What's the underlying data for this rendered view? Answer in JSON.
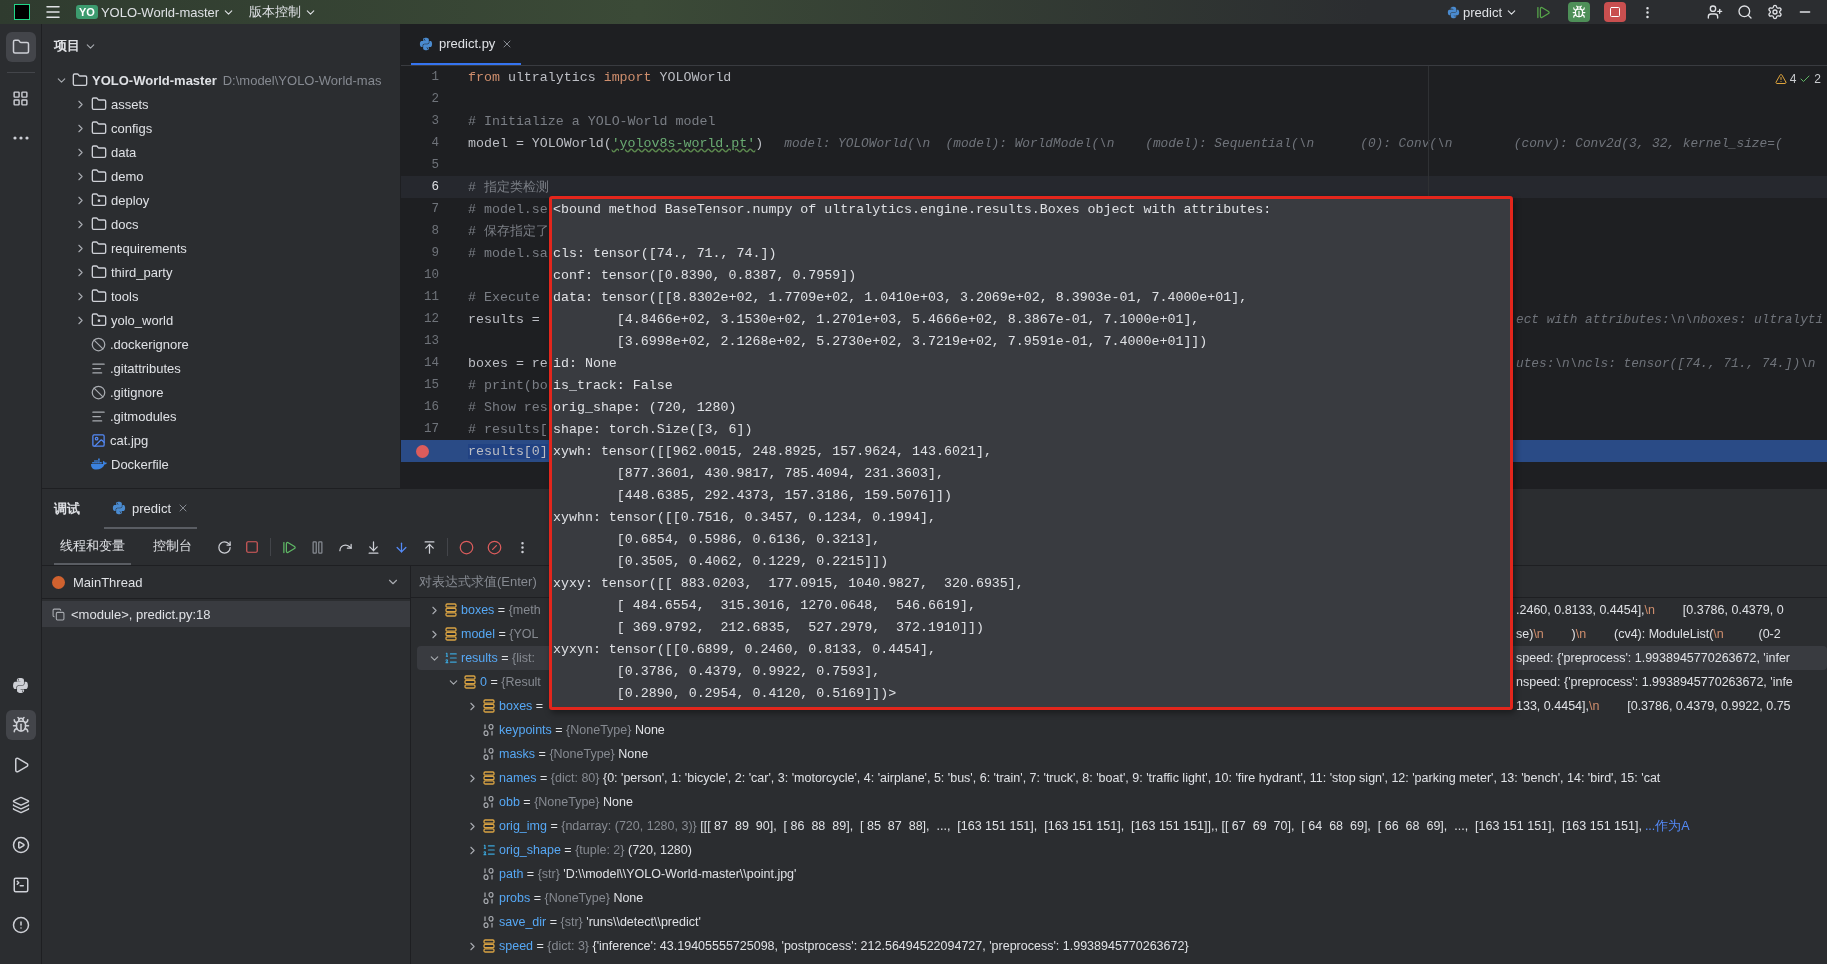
{
  "top_bar": {
    "project_badge": "YO",
    "project": "YOLO-World-master",
    "vcs": "版本控制",
    "run_config": "predict"
  },
  "project_panel": {
    "title": "项目",
    "tree": [
      {
        "name": "YOLO-World-master",
        "path": "D:\\model\\YOLO-World-mas",
        "kind": "folder",
        "expanded": true,
        "children": [
          {
            "name": "assets",
            "kind": "folder",
            "expanded": false
          },
          {
            "name": "configs",
            "kind": "folder",
            "expanded": false
          },
          {
            "name": "data",
            "kind": "folder",
            "expanded": false
          },
          {
            "name": "demo",
            "kind": "folder",
            "expanded": false
          },
          {
            "name": "deploy",
            "kind": "module",
            "expanded": false
          },
          {
            "name": "docs",
            "kind": "folder",
            "expanded": false
          },
          {
            "name": "requirements",
            "kind": "folder",
            "expanded": false
          },
          {
            "name": "third_party",
            "kind": "folder",
            "expanded": false
          },
          {
            "name": "tools",
            "kind": "folder",
            "expanded": false
          },
          {
            "name": "yolo_world",
            "kind": "module",
            "expanded": false
          },
          {
            "name": ".dockerignore",
            "kind": "ignore"
          },
          {
            "name": ".gitattributes",
            "kind": "text"
          },
          {
            "name": ".gitignore",
            "kind": "ignore"
          },
          {
            "name": ".gitmodules",
            "kind": "text"
          },
          {
            "name": "cat.jpg",
            "kind": "image"
          },
          {
            "name": "Dockerfile",
            "kind": "docker"
          }
        ]
      }
    ]
  },
  "editor": {
    "tab": "predict.py",
    "warnings": "4",
    "checks": "2",
    "lines": [
      {
        "number": "1",
        "current": false,
        "paused": false,
        "breakpoint": false,
        "code": [
          {
            "kind": "keyword",
            "text": "from"
          },
          {
            "kind": "plain",
            "text": " ultralytics "
          },
          {
            "kind": "keyword",
            "text": "import"
          },
          {
            "kind": "plain",
            "text": " YOLOWorld"
          }
        ]
      },
      {
        "number": "2",
        "current": false,
        "paused": false,
        "breakpoint": false
      },
      {
        "number": "3",
        "current": false,
        "paused": false,
        "breakpoint": false,
        "code": [
          {
            "kind": "comment",
            "text": "# Initialize a YOLO-World model"
          }
        ]
      },
      {
        "number": "4",
        "current": false,
        "paused": false,
        "breakpoint": false,
        "code": [
          {
            "kind": "plain",
            "text": "model = YOLOWorld("
          },
          {
            "kind": "string",
            "text": "'yolov8s-world.pt'"
          },
          {
            "kind": "plain",
            "text": ")"
          }
        ],
        "hint": "model: YOLOWorld(\\n  (model): WorldModel(\\n    (model): Sequential(\\n      (0): Conv(\\n        (conv): Conv2d(3, 32, kernel_size=("
      },
      {
        "number": "5",
        "current": false,
        "paused": false,
        "breakpoint": false
      },
      {
        "number": "6",
        "current": true,
        "paused": false,
        "breakpoint": false,
        "code": [
          {
            "kind": "comment",
            "text": "# 指定类检测"
          }
        ]
      },
      {
        "number": "7",
        "current": false,
        "paused": false,
        "breakpoint": false,
        "code": [
          {
            "kind": "comment",
            "text": "# model.se"
          }
        ]
      },
      {
        "number": "8",
        "current": false,
        "paused": false,
        "breakpoint": false,
        "code": [
          {
            "kind": "comment",
            "text": "# 保存指定了"
          }
        ]
      },
      {
        "number": "9",
        "current": false,
        "paused": false,
        "breakpoint": false,
        "code": [
          {
            "kind": "comment",
            "text": "# model.sa"
          }
        ]
      },
      {
        "number": "10",
        "current": false,
        "paused": false,
        "breakpoint": false
      },
      {
        "number": "11",
        "current": false,
        "paused": false,
        "breakpoint": false,
        "code": [
          {
            "kind": "comment",
            "text": "# Execute"
          }
        ]
      },
      {
        "number": "12",
        "current": false,
        "paused": false,
        "breakpoint": false,
        "code": [
          {
            "kind": "plain",
            "text": "results ="
          }
        ],
        "hint_after_popup": "ect with attributes:\\n\\nboxes: ultralyti"
      },
      {
        "number": "13",
        "current": false,
        "paused": false,
        "breakpoint": false
      },
      {
        "number": "14",
        "current": false,
        "paused": false,
        "breakpoint": false,
        "code": [
          {
            "kind": "plain",
            "text": "boxes = re"
          }
        ],
        "hint_after_popup": "utes:\\n\\ncls: tensor([74., 71., 74.])\\n"
      },
      {
        "number": "15",
        "current": false,
        "paused": false,
        "breakpoint": false,
        "code": [
          {
            "kind": "comment",
            "text": "# print(bo"
          }
        ]
      },
      {
        "number": "16",
        "current": false,
        "paused": false,
        "breakpoint": false,
        "code": [
          {
            "kind": "comment",
            "text": "# Show res"
          }
        ]
      },
      {
        "number": "17",
        "current": false,
        "paused": false,
        "breakpoint": false,
        "code": [
          {
            "kind": "comment",
            "text": "# results["
          }
        ]
      },
      {
        "current": false,
        "paused": true,
        "breakpoint": true,
        "code": [
          {
            "kind": "selection",
            "text": "results[0]"
          }
        ]
      }
    ]
  },
  "popup": {
    "text": "<bound method BaseTensor.numpy of ultralytics.engine.results.Boxes object with attributes:\n\ncls: tensor([74., 71., 74.])\nconf: tensor([0.8390, 0.8387, 0.7959])\ndata: tensor([[8.8302e+02, 1.7709e+02, 1.0410e+03, 3.2069e+02, 8.3903e-01, 7.4000e+01],\n        [4.8466e+02, 3.1530e+02, 1.2701e+03, 5.4666e+02, 8.3867e-01, 7.1000e+01],\n        [3.6998e+02, 2.1268e+02, 5.2730e+02, 3.7219e+02, 7.9591e-01, 7.4000e+01]])\nid: None\nis_track: False\norig_shape: (720, 1280)\nshape: torch.Size([3, 6])\nxywh: tensor([[962.0015, 248.8925, 157.9624, 143.6021],\n        [877.3601, 430.9817, 785.4094, 231.3603],\n        [448.6385, 292.4373, 157.3186, 159.5076]])\nxywhn: tensor([[0.7516, 0.3457, 0.1234, 0.1994],\n        [0.6854, 0.5986, 0.6136, 0.3213],\n        [0.3505, 0.4062, 0.1229, 0.2215]])\nxyxy: tensor([[ 883.0203,  177.0915, 1040.9827,  320.6935],\n        [ 484.6554,  315.3016, 1270.0648,  546.6619],\n        [ 369.9792,  212.6835,  527.2979,  372.1910]])\nxyxyn: tensor([[0.6899, 0.2460, 0.8133, 0.4454],\n        [0.3786, 0.4379, 0.9922, 0.7593],\n        [0.2890, 0.2954, 0.4120, 0.5169]])>"
  },
  "debugger": {
    "title": "调试",
    "session_tab": "predict",
    "tabs": [
      {
        "label": "线程和变量",
        "selected": true
      },
      {
        "label": "控制台",
        "selected": false
      }
    ],
    "thread": "MainThread",
    "frames": [
      {
        "label": "<module>, predict.py:18",
        "selected": true
      }
    ],
    "evaluate_placeholder": "对表达式求值(Enter)",
    "variables": [
      {
        "name": "boxes",
        "sep": "=",
        "type": "{meth",
        "kind": "object",
        "expanded": false,
        "selected": false,
        "after_popup": ".2460, 0.8133, 0.4454],\\n        [0.3786, 0.4379, 0"
      },
      {
        "name": "model",
        "sep": "=",
        "type": "{YOL",
        "kind": "object",
        "expanded": false,
        "selected": false,
        "after_popup": "se)\\n        )\\n        (cv4): ModuleList(\\n          (0-2"
      },
      {
        "name": "results",
        "sep": "=",
        "type": "{list:",
        "kind": "list",
        "expanded": true,
        "selected": true,
        "after_popup": "speed: {'preprocess': 1.9938945770263672, 'infer",
        "children": [
          {
            "name": "0",
            "sep": "=",
            "type": "{Result",
            "kind": "object",
            "expanded": true,
            "selected": false,
            "after_popup": "nspeed: {'preprocess': 1.9938945770263672, 'infe",
            "children": [
              {
                "name": "boxes",
                "sep": "=",
                "kind": "object",
                "expanded": false,
                "selected": false,
                "after_popup": "133, 0.4454],\\n        [0.3786, 0.4379, 0.9922, 0.75"
              },
              {
                "name": "keypoints",
                "sep": "=",
                "type": "{NoneType}",
                "value": "None",
                "kind": "primitive",
                "selected": false
              },
              {
                "name": "masks",
                "sep": "=",
                "type": "{NoneType}",
                "value": "None",
                "kind": "primitive",
                "selected": false
              },
              {
                "name": "names",
                "sep": "=",
                "type": "{dict: 80}",
                "value": "{0: 'person', 1: 'bicycle', 2: 'car', 3: 'motorcycle', 4: 'airplane', 5: 'bus', 6: 'train', 7: 'truck', 8: 'boat', 9: 'traffic light', 10: 'fire hydrant', 11: 'stop sign', 12: 'parking meter', 13: 'bench', 14: 'bird', 15: 'cat",
                "kind": "object",
                "expanded": false,
                "selected": false
              },
              {
                "name": "obb",
                "sep": "=",
                "type": "{NoneType}",
                "value": "None",
                "kind": "primitive",
                "selected": false
              },
              {
                "name": "orig_img",
                "sep": "=",
                "type": "{ndarray: (720, 1280, 3)}",
                "value": "[[[ 87  89  90],  [ 86  88  89],  [ 85  87  88],  ...,  [163 151 151],  [163 151 151],  [163 151 151]],, [[ 67  69  70],  [ 64  68  69],  [ 66  68  69],  ...,  [163 151 151],  [163 151 151],",
                "link": "...作为A",
                "kind": "object",
                "expanded": false,
                "selected": false
              },
              {
                "name": "orig_shape",
                "sep": "=",
                "type": "{tuple: 2}",
                "value": "(720, 1280)",
                "kind": "list",
                "expanded": false,
                "selected": false
              },
              {
                "name": "path",
                "sep": "=",
                "type": "{str}",
                "value": "'D:\\\\model\\\\YOLO-World-master\\\\point.jpg'",
                "kind": "primitive",
                "selected": false
              },
              {
                "name": "probs",
                "sep": "=",
                "type": "{NoneType}",
                "value": "None",
                "kind": "primitive",
                "selected": false
              },
              {
                "name": "save_dir",
                "sep": "=",
                "type": "{str}",
                "value": "'runs\\\\detect\\\\predict'",
                "kind": "primitive",
                "selected": false
              },
              {
                "name": "speed",
                "sep": "=",
                "type": "{dict: 3}",
                "value": "{'inference': 43.19405555725098, 'postprocess': 212.56494522094727, 'preprocess': 1.9938945770263672}",
                "kind": "object",
                "expanded": false,
                "selected": false
              }
            ]
          }
        ]
      }
    ]
  }
}
